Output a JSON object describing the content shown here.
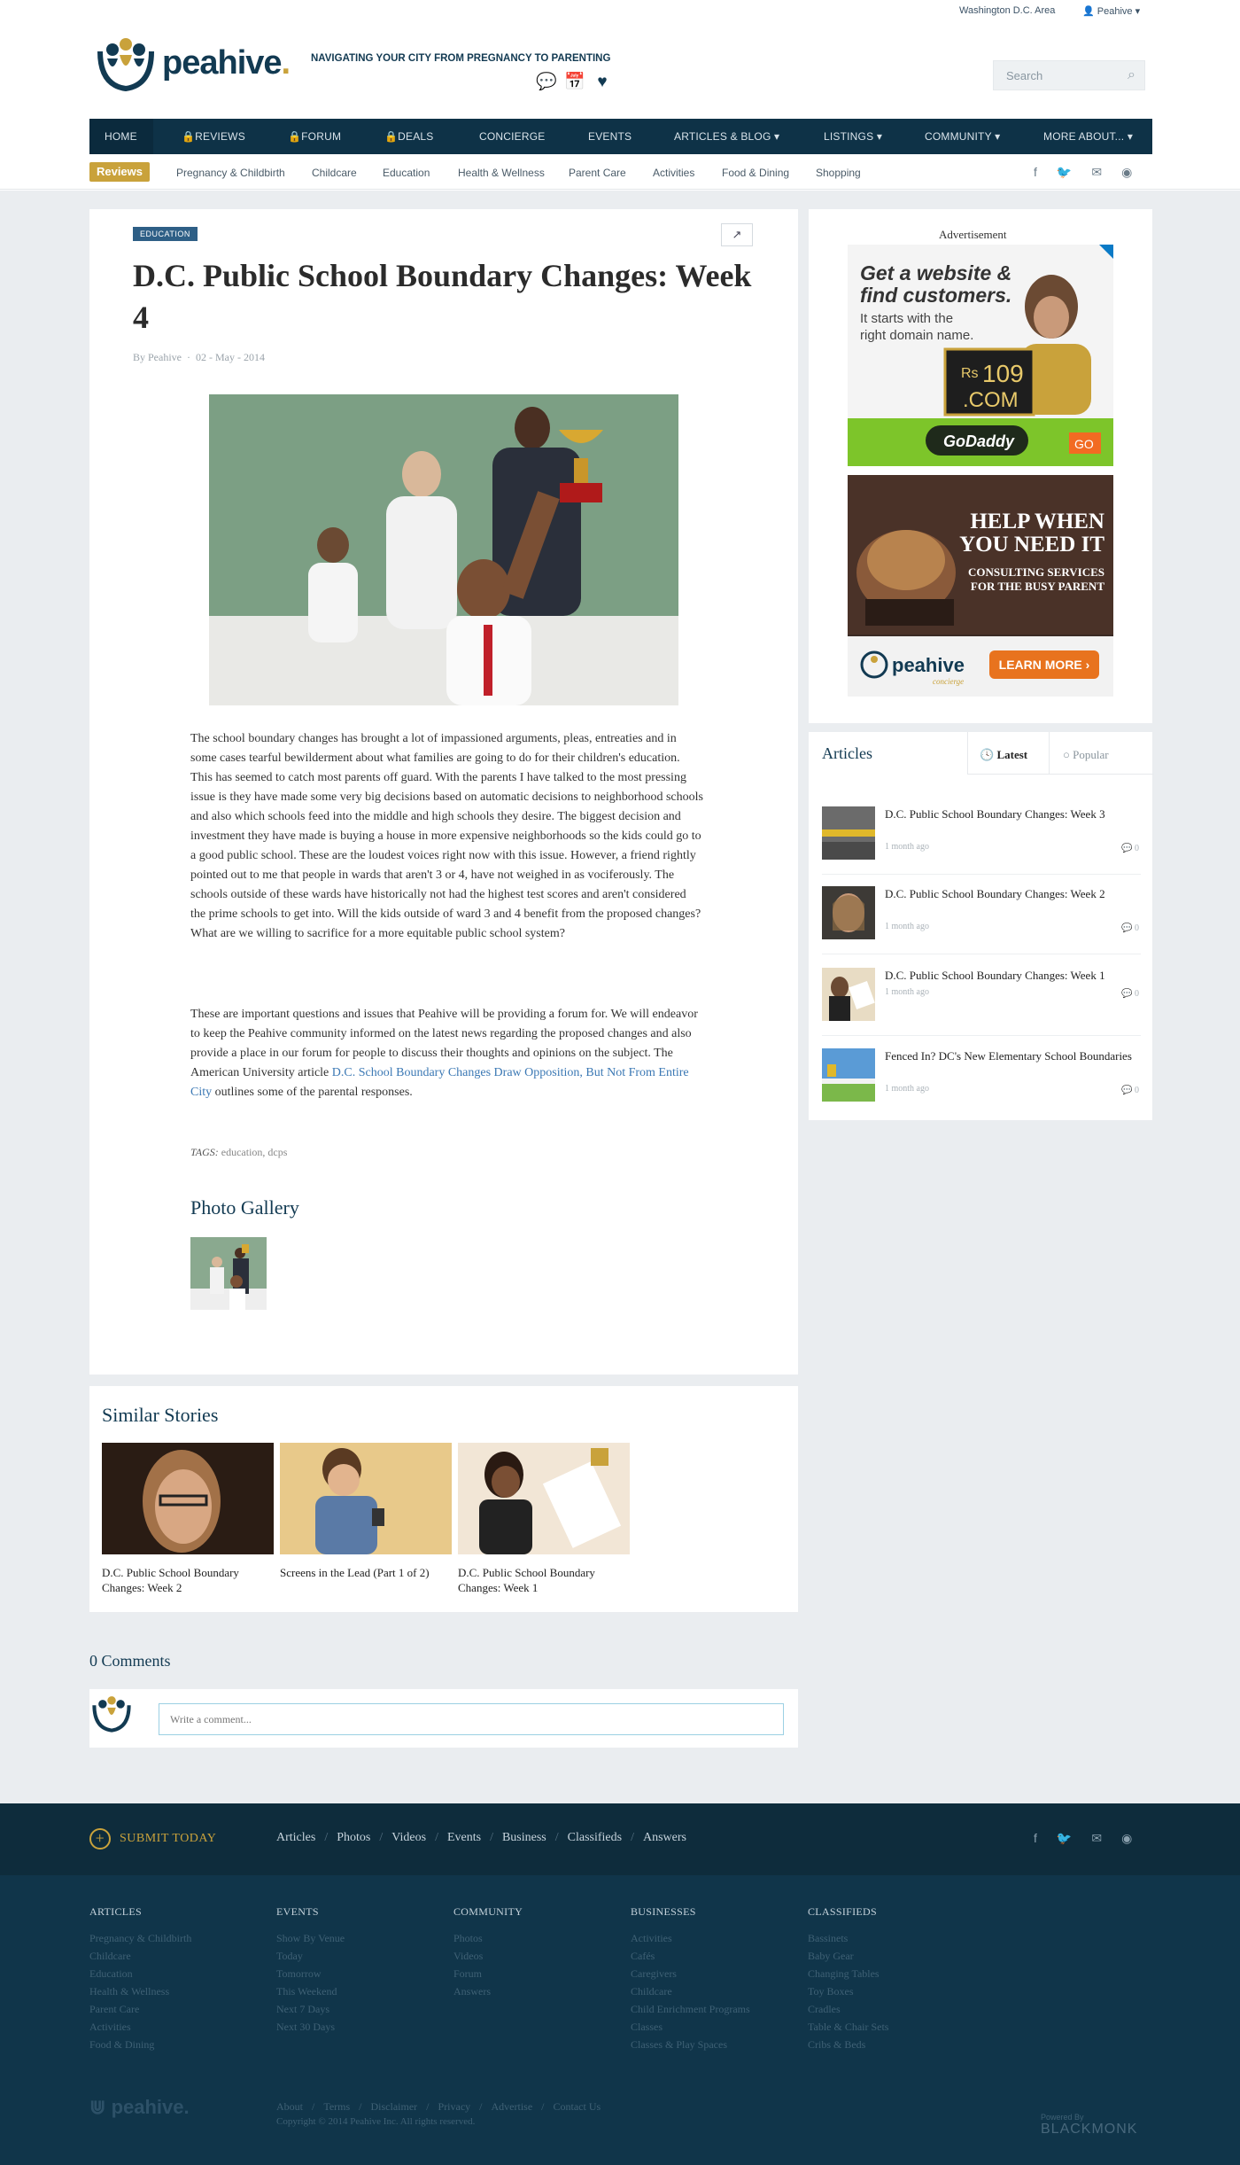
{
  "topbar": {
    "city": "Washington D.C. Area",
    "user": "Peahive"
  },
  "header": {
    "logo": "peahive",
    "tagline": "NAVIGATING YOUR CITY FROM PREGNANCY TO PARENTING",
    "search_placeholder": "Search"
  },
  "nav": [
    "HOME",
    "REVIEWS",
    "FORUM",
    "DEALS",
    "CONCIERGE",
    "EVENTS",
    "ARTICLES & BLOG",
    "LISTINGS",
    "COMMUNITY",
    "MORE ABOUT..."
  ],
  "subnav": {
    "badge": "Reviews",
    "items": [
      "Pregnancy & Childbirth",
      "Childcare",
      "Education",
      "Health & Wellness",
      "Parent Care",
      "Activities",
      "Food & Dining",
      "Shopping"
    ]
  },
  "article": {
    "category": "EDUCATION",
    "title": "D.C. Public School Boundary Changes: Week 4",
    "author": "By Peahive",
    "date": "02 - May - 2014",
    "p1": "The school boundary changes has brought a lot of impassioned arguments, pleas, entreaties and in some cases tearful bewilderment about what families are going to do for their children's education. This has seemed to catch most parents off guard. With the parents I have talked to the most pressing issue is they have made some very big decisions based on automatic decisions to neighborhood schools and also which schools feed into the middle and high schools they desire. The biggest decision and investment they have made is buying a house in more expensive neighborhoods so the kids could go to a good public school. These are the loudest voices right now with this issue. However, a friend rightly pointed out to me that people in wards that aren't 3 or 4, have not weighed in as vociferously. The schools outside of these wards have historically not had the highest test scores and aren't considered the prime schools to get into. Will the kids outside of ward 3 and 4 benefit from the proposed changes? What are we willing to sacrifice for a more equitable public school system?",
    "p2_a": "These are important questions and issues that Peahive will be providing a forum for. We will endeavor to keep the Peahive community informed on the latest news regarding the proposed changes and also provide a place in our forum for people to discuss their thoughts and opinions on the subject. The American University article ",
    "p2_link": "D.C. School Boundary Changes Draw Opposition, But Not From Entire City",
    "p2_b": " outlines some of the parental responses.",
    "tags_label": "TAGS:",
    "tags": "education, dcps",
    "gallery_title": "Photo Gallery"
  },
  "sidebar": {
    "ad_label": "Advertisement",
    "ad1": {
      "line1": "Get a website &",
      "line2": "find customers.",
      "line3": "It starts with the",
      "line4": "right domain name.",
      "price_prefix": "Rs",
      "price": "109",
      "tld": ".COM",
      "brand": "GoDaddy",
      "cta": "GO"
    },
    "ad2": {
      "line1": "HELP WHEN",
      "line2": "YOU NEED IT",
      "line3": "CONSULTING SERVICES",
      "line4": "FOR THE BUSY PARENT",
      "brand": "peahive",
      "sub": "concierge",
      "cta": "LEARN MORE ›"
    },
    "articles_title": "Articles",
    "tab_latest": "Latest",
    "tab_popular": "Popular",
    "items": [
      {
        "title": "D.C. Public School Boundary Changes: Week 3",
        "ago": "1 month ago",
        "comments": "0"
      },
      {
        "title": "D.C. Public School Boundary Changes: Week 2",
        "ago": "1 month ago",
        "comments": "0"
      },
      {
        "title": "D.C. Public School Boundary Changes: Week 1",
        "ago": "1 month ago",
        "comments": "0"
      },
      {
        "title": "Fenced In? DC's New Elementary School Boundaries",
        "ago": "1 month ago",
        "comments": "0"
      }
    ]
  },
  "similar": {
    "title": "Similar Stories",
    "items": [
      {
        "caption": "D.C. Public School Boundary Changes: Week 2"
      },
      {
        "caption": "Screens in the Lead (Part 1 of 2)"
      },
      {
        "caption": "D.C. Public School Boundary Changes: Week 1"
      }
    ]
  },
  "comments": {
    "title": "0 Comments",
    "placeholder": "Write a comment..."
  },
  "footer": {
    "submit": "SUBMIT TODAY",
    "links": [
      "Articles",
      "Photos",
      "Videos",
      "Events",
      "Business",
      "Classifieds",
      "Answers"
    ],
    "columns": [
      {
        "heading": "ARTICLES",
        "items": [
          "Pregnancy & Childbirth",
          "Childcare",
          "Education",
          "Health & Wellness",
          "Parent Care",
          "Activities",
          "Food & Dining"
        ]
      },
      {
        "heading": "EVENTS",
        "items": [
          "Show By Venue",
          "Today",
          "Tomorrow",
          "This Weekend",
          "Next 7 Days",
          "Next 30 Days"
        ]
      },
      {
        "heading": "COMMUNITY",
        "items": [
          "Photos",
          "Videos",
          "Forum",
          "Answers"
        ]
      },
      {
        "heading": "BUSINESSES",
        "items": [
          "Activities",
          "Cafés",
          "Caregivers",
          "Childcare",
          "Child Enrichment Programs",
          "Classes",
          "Classes & Play Spaces"
        ]
      },
      {
        "heading": "CLASSIFIEDS",
        "items": [
          "Bassinets",
          "Baby Gear",
          "Changing Tables",
          "Toy Boxes",
          "Cradles",
          "Table & Chair Sets",
          "Cribs & Beds"
        ]
      }
    ],
    "logo": "peahive.",
    "bottom_links": [
      "About",
      "Terms",
      "Disclaimer",
      "Privacy",
      "Advertise",
      "Contact Us"
    ],
    "copyright": "Copyright © 2014 Peahive Inc. All rights reserved.",
    "powered_by": "Powered By",
    "powered_brand": "BLACKMONK"
  },
  "colors": {
    "navy": "#0e3247",
    "gold": "#c9a23b",
    "link": "#3b78b4",
    "footer": "#10354a"
  }
}
